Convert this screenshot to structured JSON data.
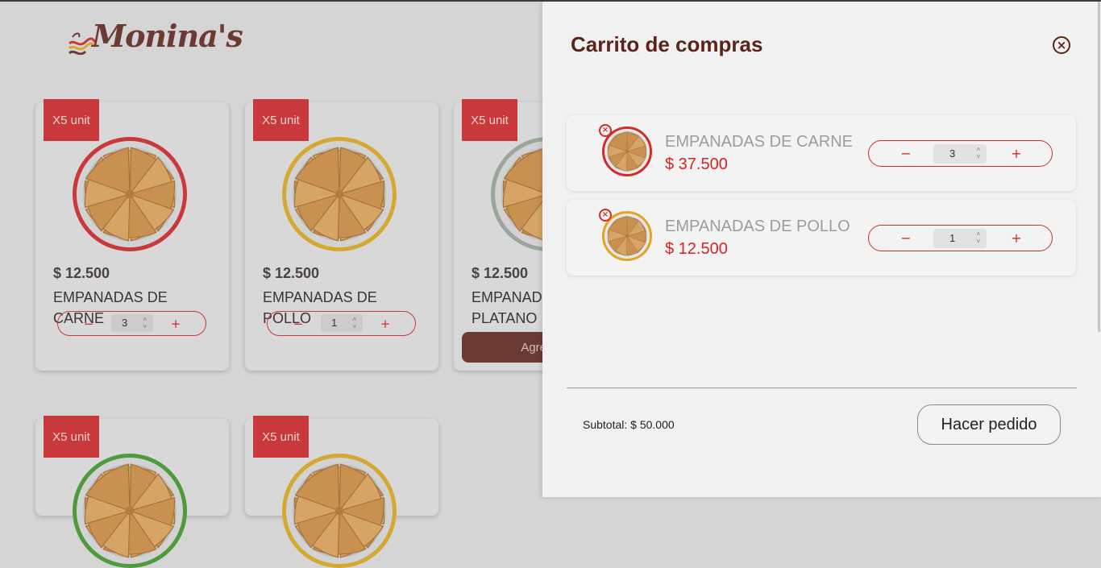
{
  "brand": {
    "logo_text": "Monina's"
  },
  "products": [
    {
      "badge": "X5 unit",
      "price": "$ 12.500",
      "name": "EMPANADAS DE CARNE",
      "qty": "3",
      "ring_color": "#c9383a"
    },
    {
      "badge": "X5 unit",
      "price": "$ 12.500",
      "name": "EMPANADAS DE POLLO",
      "qty": "1",
      "ring_color": "#d5a830"
    },
    {
      "badge": "X5 unit",
      "price": "$ 12.500",
      "name": "EMPANADAS DE PLATANO",
      "add_label": "Agregar",
      "ring_color": "#9aa69a"
    },
    {
      "badge": "X5 unit",
      "ring_color": "#4f9a3a"
    },
    {
      "badge": "X5 unit",
      "ring_color": "#d5a830"
    }
  ],
  "stepper": {
    "minus": "−",
    "plus": "+"
  },
  "cart": {
    "title": "Carrito de compras",
    "close_icon": "close-circle-icon",
    "items": [
      {
        "name": "EMPANADAS DE CARNE",
        "price": "$ 37.500",
        "qty": "3",
        "ring_color": "#d22b2b"
      },
      {
        "name": "EMPANADAS DE POLLO",
        "price": "$ 12.500",
        "qty": "1",
        "ring_color": "#e3a41f"
      }
    ],
    "subtotal": "Subtotal: $ 50.000",
    "order_button": "Hacer pedido"
  },
  "colors": {
    "accent": "#d22b2b",
    "brand_brown": "#5b2418",
    "badge": "#c9383a"
  }
}
